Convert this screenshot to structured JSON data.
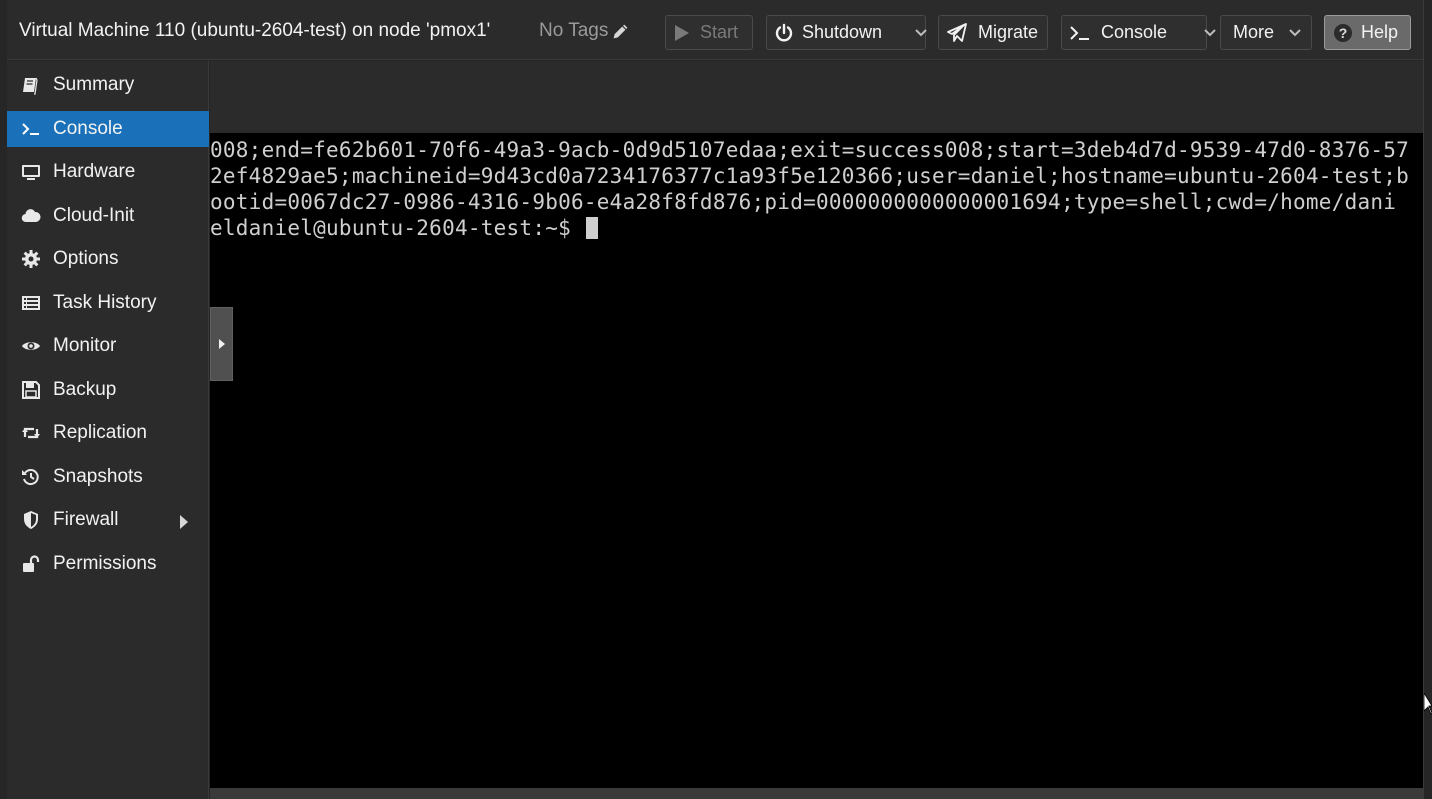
{
  "header": {
    "title": "Virtual Machine 110 (ubuntu-2604-test) on node 'pmox1'",
    "tags_label": "No Tags",
    "buttons": {
      "start": "Start",
      "shutdown": "Shutdown",
      "migrate": "Migrate",
      "console": "Console",
      "more": "More",
      "help": "Help"
    }
  },
  "sidebar": {
    "items": [
      {
        "label": "Summary",
        "icon": "book-icon"
      },
      {
        "label": "Console",
        "icon": "terminal-icon",
        "active": true
      },
      {
        "label": "Hardware",
        "icon": "monitor-icon"
      },
      {
        "label": "Cloud-Init",
        "icon": "cloud-icon"
      },
      {
        "label": "Options",
        "icon": "gear-icon"
      },
      {
        "label": "Task History",
        "icon": "list-icon"
      },
      {
        "label": "Monitor",
        "icon": "eye-icon"
      },
      {
        "label": "Backup",
        "icon": "floppy-icon"
      },
      {
        "label": "Replication",
        "icon": "retweet-icon"
      },
      {
        "label": "Snapshots",
        "icon": "history-icon"
      },
      {
        "label": "Firewall",
        "icon": "shield-icon"
      },
      {
        "label": "Permissions",
        "icon": "unlock-icon"
      }
    ]
  },
  "terminal": {
    "lines": [
      "008;end=fe62b601-70f6-49a3-9acb-0d9d5107edaa;exit=success008;start=3deb4d7d-9539-47d0-8376-57",
      "2ef4829ae5;machineid=9d43cd0a7234176377c1a93f5e120366;user=daniel;hostname=ubuntu-2604-test;b",
      "ootid=0067dc27-0986-4316-9b06-e4a28f8fd876;pid=0000000000000001694;type=shell;cwd=/home/dani",
      "eldaniel@ubuntu-2604-test:~$ "
    ]
  },
  "colors": {
    "accent": "#1a71b9",
    "background": "#2b2b2b",
    "terminal_bg": "#000000",
    "terminal_fg": "#cfcfcf"
  }
}
